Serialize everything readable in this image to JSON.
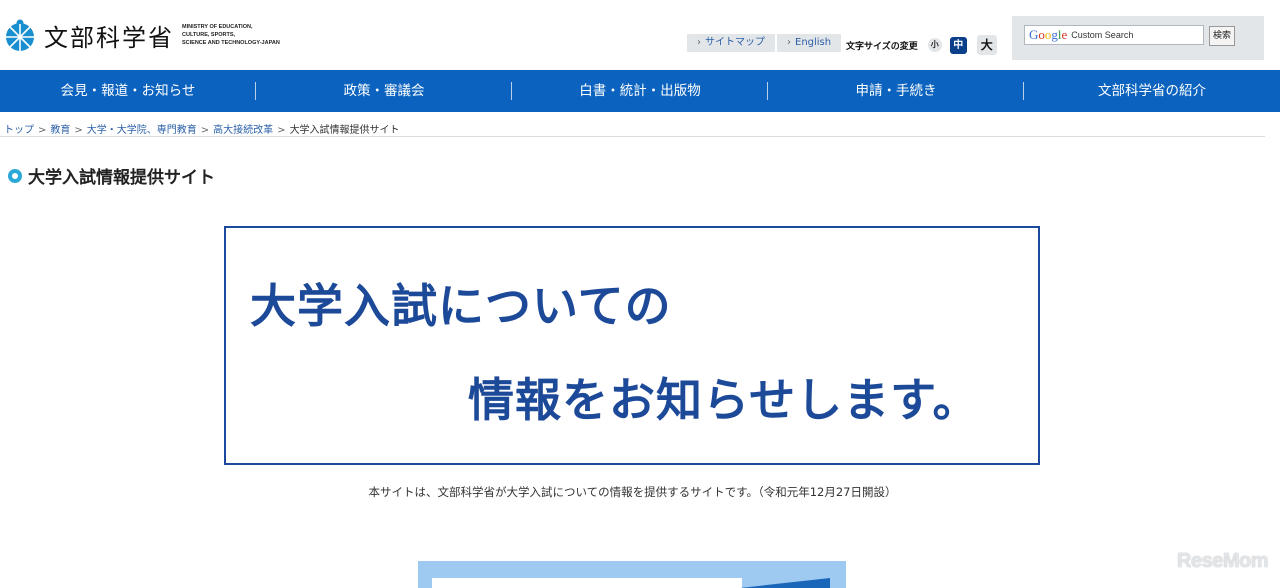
{
  "header": {
    "logo_ja": "文部科学省",
    "logo_en": [
      "MINISTRY OF EDUCATION,",
      "CULTURE, SPORTS,",
      "SCIENCE AND TECHNOLOGY-JAPAN"
    ],
    "sitemap_label": "サイトマップ",
    "english_label": "English",
    "font_size_label": "文字サイズの変更",
    "font_small": "小",
    "font_medium": "中",
    "font_large": "大"
  },
  "search": {
    "google_logo": "Google",
    "placeholder": "Custom Search",
    "button_label": "検索"
  },
  "nav": {
    "items": [
      {
        "label": "会見・報道・お知らせ"
      },
      {
        "label": "政策・審議会"
      },
      {
        "label": "白書・統計・出版物"
      },
      {
        "label": "申請・手続き"
      },
      {
        "label": "文部科学省の紹介"
      }
    ]
  },
  "breadcrumb": {
    "items": [
      {
        "label": "トップ"
      },
      {
        "label": "教育"
      },
      {
        "label": "大学・大学院、専門教育"
      },
      {
        "label": "高大接続改革"
      }
    ],
    "current": "大学入試情報提供サイト",
    "separator": ">"
  },
  "page": {
    "title": "大学入試情報提供サイト",
    "hero_line1": "大学入試についての",
    "hero_line2": "情報をお知らせします。",
    "notice": "本サイトは、文部科学省が大学入試についての情報を提供するサイトです。（令和元年12月27日開設）"
  },
  "watermark": "ReseMom",
  "colors": {
    "nav_bg": "#0b63bf",
    "hero_text": "#1d4a98",
    "hero_border": "#1b4a9c",
    "link": "#2a5fa7",
    "title_dot": "#2aa9d9"
  }
}
